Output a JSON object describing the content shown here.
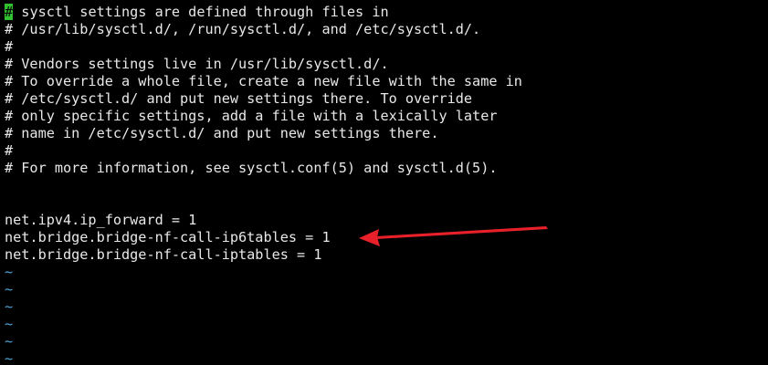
{
  "editor": {
    "cursor_char": "#",
    "first_line_rest": " sysctl settings are defined through files in",
    "lines": [
      "# /usr/lib/sysctl.d/, /run/sysctl.d/, and /etc/sysctl.d/.",
      "#",
      "# Vendors settings live in /usr/lib/sysctl.d/.",
      "# To override a whole file, create a new file with the same in",
      "# /etc/sysctl.d/ and put new settings there. To override",
      "# only specific settings, add a file with a lexically later",
      "# name in /etc/sysctl.d/ and put new settings there.",
      "#",
      "# For more information, see sysctl.conf(5) and sysctl.d(5).",
      "",
      "",
      "net.ipv4.ip_forward = 1",
      "net.bridge.bridge-nf-call-ip6tables = 1",
      "net.bridge.bridge-nf-call-iptables = 1"
    ],
    "empty_line_marker": "~",
    "colors": {
      "background": "#000000",
      "text": "#e8e8e8",
      "cursor": "#30c030",
      "tilde": "#4fa3d8",
      "annotation_arrow": "#e8202a"
    }
  }
}
